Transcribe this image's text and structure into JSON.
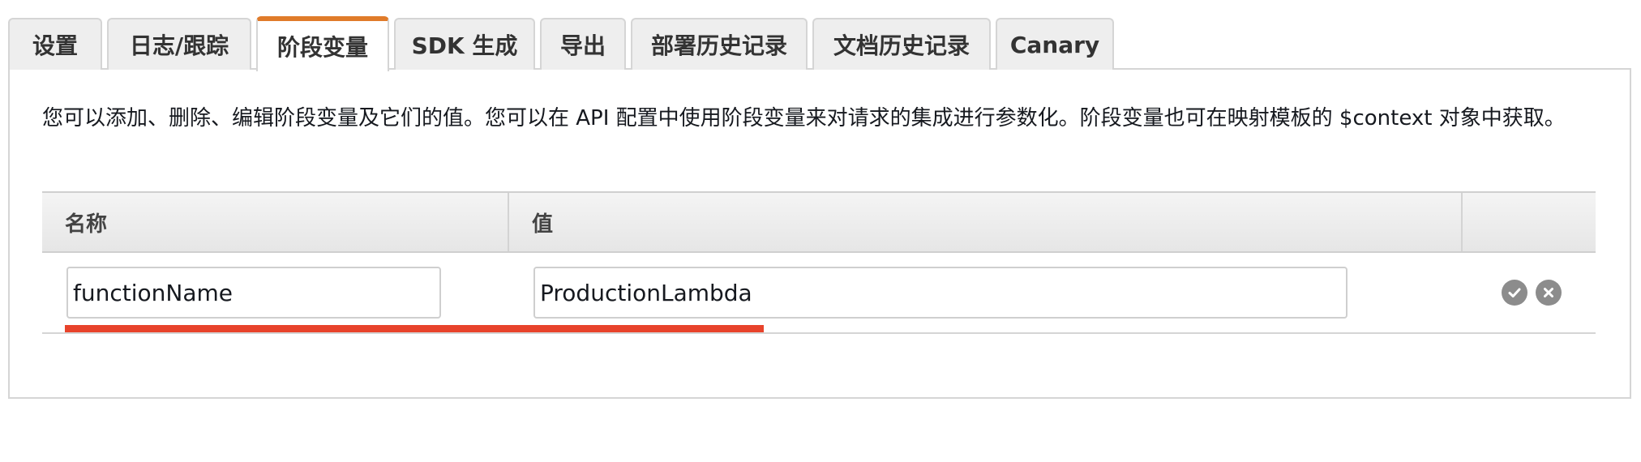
{
  "tabs": [
    {
      "label": "设置"
    },
    {
      "label": "日志/跟踪"
    },
    {
      "label": "阶段变量"
    },
    {
      "label": "SDK 生成"
    },
    {
      "label": "导出"
    },
    {
      "label": "部署历史记录"
    },
    {
      "label": "文档历史记录"
    },
    {
      "label": "Canary"
    }
  ],
  "active_tab": "阶段变量",
  "description": "您可以添加、删除、编辑阶段变量及它们的值。您可以在 API 配置中使用阶段变量来对请求的集成进行参数化。阶段变量也可在映射模板的 $context 对象中获取。",
  "table": {
    "headers": {
      "name": "名称",
      "value": "值",
      "actions": ""
    },
    "rows": [
      {
        "name": "functionName",
        "value": "ProductionLambda"
      }
    ]
  },
  "icons": {
    "confirm": "check-circle-icon",
    "cancel": "x-circle-icon"
  },
  "colors": {
    "active_tab_accent": "#e07b2a",
    "highlight": "#e8432b",
    "icon_gray": "#8c8c8c"
  }
}
